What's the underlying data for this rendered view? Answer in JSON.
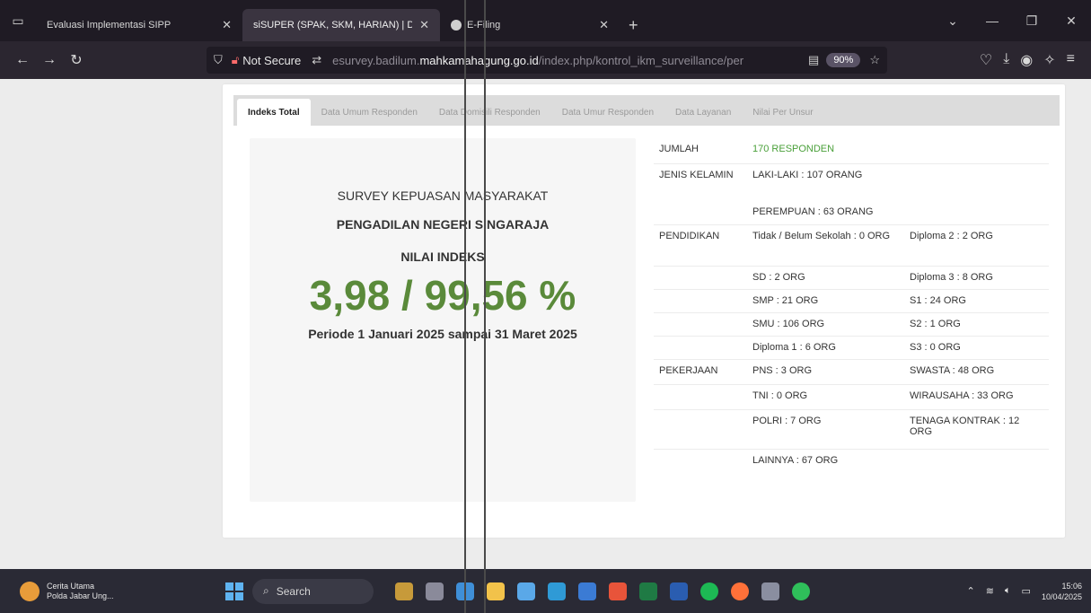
{
  "browser": {
    "tabs": [
      {
        "title": "Evaluasi Implementasi SIPP",
        "active": false
      },
      {
        "title": "siSUPER (SPAK, SKM, HARIAN) | Da",
        "active": true
      },
      {
        "title": "E-Filing",
        "active": false
      }
    ],
    "new_tab": "+",
    "url_security": "Not Secure",
    "url_pre": "esurvey.badilum.",
    "url_host": "mahkamahagung.go.id",
    "url_path": "/index.php/kontrol_ikm_surveillance/per",
    "zoom": "90%"
  },
  "page_tabs": [
    {
      "label": "Indeks Total",
      "active": true
    },
    {
      "label": "Data Umum Responden"
    },
    {
      "label": "Data Domisili Responden"
    },
    {
      "label": "Data Umur Responden"
    },
    {
      "label": "Data Layanan"
    },
    {
      "label": "Nilai Per Unsur"
    }
  ],
  "summary": {
    "survey_title": "SURVEY KEPUASAN MASYARAKAT",
    "court": "PENGADILAN NEGERI SINGARAJA",
    "index_label": "NILAI INDEKS",
    "score": "3,98 / 99,56 %",
    "period": "Periode 1 Januari 2025 sampai 31 Maret 2025"
  },
  "stats": {
    "jumlah_label": "JUMLAH",
    "jumlah_value": "170 RESPONDEN",
    "gender_label": "JENIS KELAMIN",
    "male": "LAKI-LAKI : 107 ORANG",
    "female": "PEREMPUAN : 63 ORANG",
    "edu_label": "PENDIDIKAN",
    "edu": [
      [
        "Tidak / Belum Sekolah : 0 ORG",
        "Diploma 2 : 2 ORG"
      ],
      [
        "SD : 2 ORG",
        "Diploma 3 : 8 ORG"
      ],
      [
        "SMP : 21 ORG",
        "S1 : 24 ORG"
      ],
      [
        "SMU : 106 ORG",
        "S2 : 1 ORG"
      ],
      [
        "Diploma 1 : 6 ORG",
        "S3 : 0 ORG"
      ]
    ],
    "job_label": "PEKERJAAN",
    "jobs": [
      [
        "PNS : 3 ORG",
        "SWASTA : 48 ORG"
      ],
      [
        "TNI : 0 ORG",
        "WIRAUSAHA : 33 ORG"
      ],
      [
        "POLRI : 7 ORG",
        "TENAGA KONTRAK : 12 ORG"
      ],
      [
        "LAINNYA : 67 ORG",
        ""
      ]
    ]
  },
  "taskbar": {
    "news_title": "Cerita Utama",
    "news_sub": "Polda Jabar Ung...",
    "search_placeholder": "Search",
    "time": "15:06",
    "date": "10/04/2025"
  }
}
